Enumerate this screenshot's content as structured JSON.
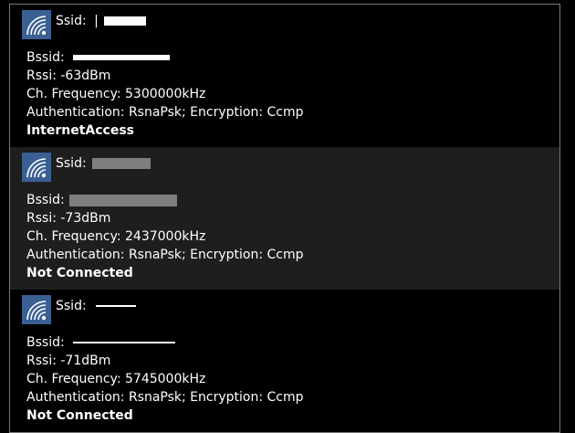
{
  "networks": [
    {
      "ssid_label": "Ssid:",
      "ssid_prefix": "|",
      "bssid_label": "Bssid:",
      "rssi": "Rssi: -63dBm",
      "frequency": "Ch. Frequency: 5300000kHz",
      "security": "Authentication: RsnaPsk; Encryption: Ccmp",
      "status": "InternetAccess",
      "icon": "wifi-icon",
      "selected": false
    },
    {
      "ssid_label": "Ssid:",
      "ssid_prefix": "",
      "bssid_label": "Bssid:",
      "rssi": "Rssi: -73dBm",
      "frequency": "Ch. Frequency: 2437000kHz",
      "security": "Authentication: RsnaPsk; Encryption: Ccmp",
      "status": "Not Connected",
      "icon": "wifi-icon",
      "selected": true
    },
    {
      "ssid_label": "Ssid:",
      "ssid_prefix": "",
      "bssid_label": "Bssid:",
      "rssi": "Rssi: -71dBm",
      "frequency": "Ch. Frequency: 5745000kHz",
      "security": "Authentication: RsnaPsk; Encryption: Ccmp",
      "status": "Not Connected",
      "icon": "wifi-icon",
      "selected": false
    }
  ],
  "colors": {
    "background": "#000000",
    "selected_background": "#1e1e1e",
    "icon_tile": "#3a5f93",
    "border": "#7a7a7a",
    "text": "#ffffff"
  }
}
